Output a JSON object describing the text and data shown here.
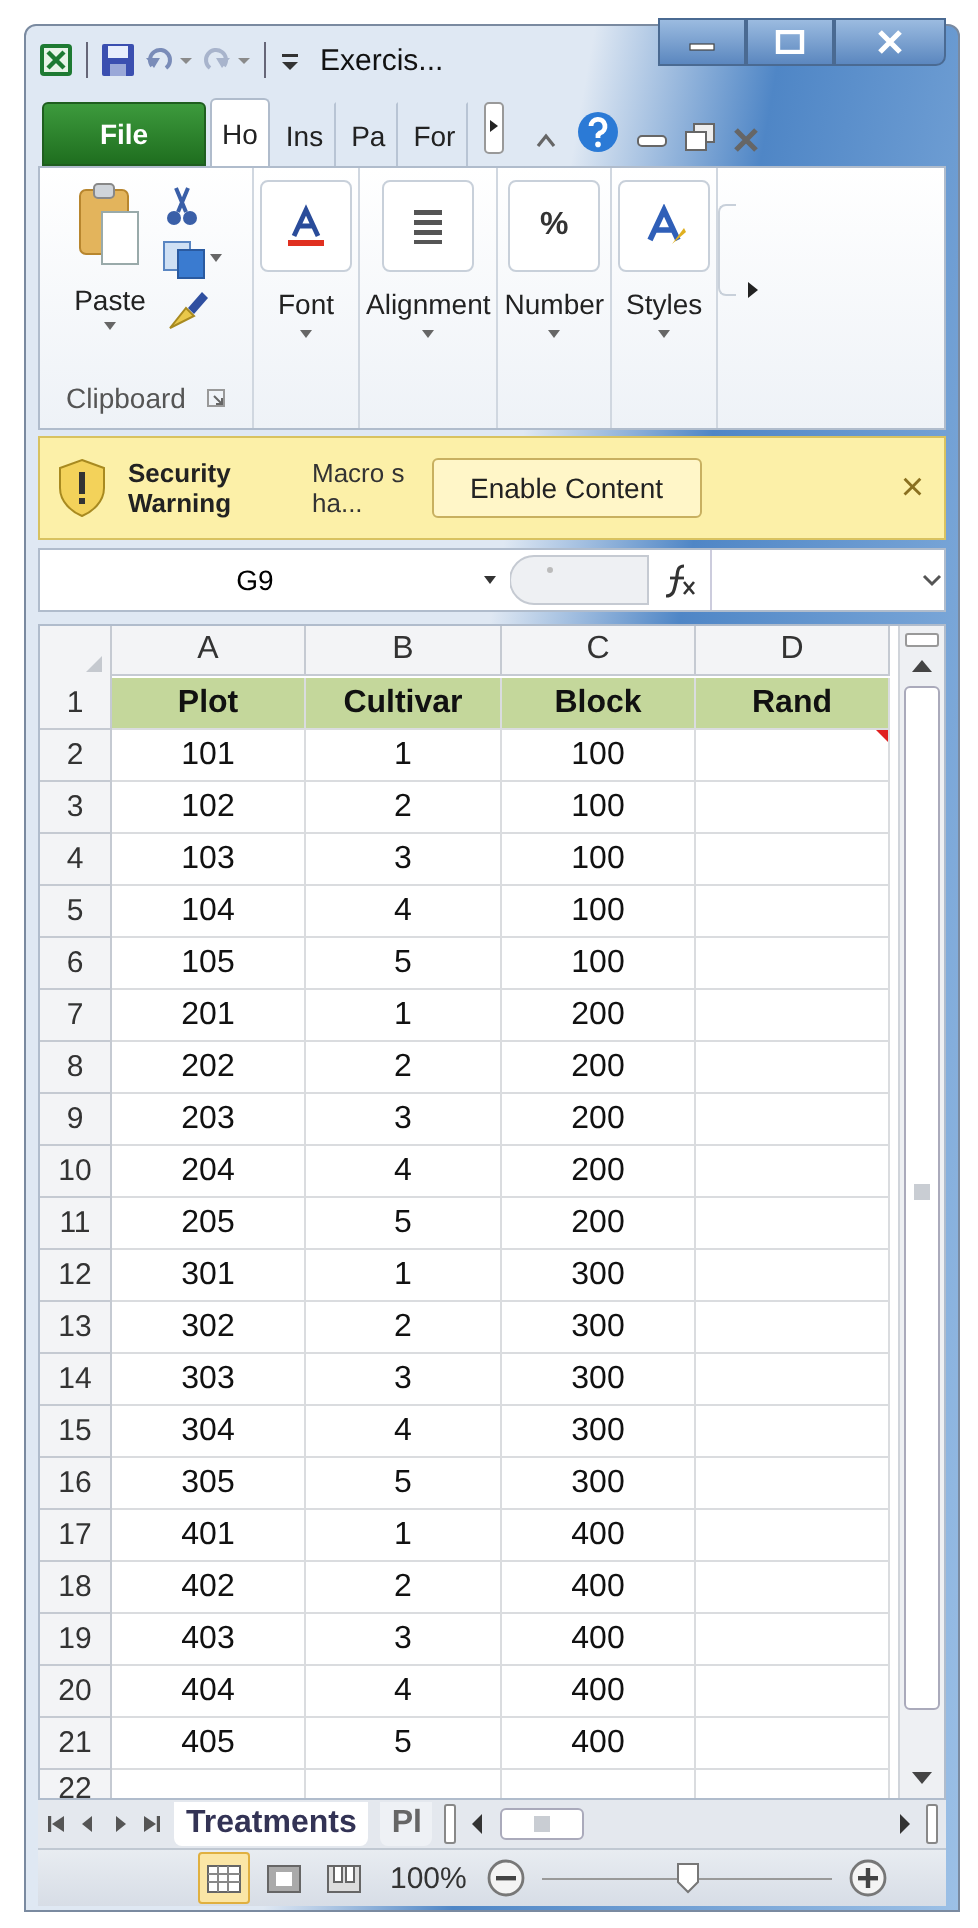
{
  "window": {
    "title": "Exercis..."
  },
  "ribbon_tabs": [
    {
      "label": "File",
      "kind": "file",
      "selected": false
    },
    {
      "label": "Ho",
      "kind": "tab",
      "selected": true
    },
    {
      "label": "Ins",
      "kind": "tab",
      "selected": false
    },
    {
      "label": "Pa",
      "kind": "tab",
      "selected": false
    },
    {
      "label": "For",
      "kind": "tab",
      "selected": false
    }
  ],
  "ribbon": {
    "clipboard": {
      "paste": "Paste",
      "group": "Clipboard"
    },
    "groups": [
      {
        "label": "Font",
        "kind": "font"
      },
      {
        "label": "Alignment",
        "kind": "alignment"
      },
      {
        "label": "Number",
        "kind": "number",
        "icon_text": "%"
      },
      {
        "label": "Styles",
        "kind": "styles"
      }
    ]
  },
  "security_bar": {
    "title": "Security Warning",
    "message": "Macro s ha...",
    "button": "Enable Content",
    "close": "×"
  },
  "formula_bar": {
    "name_box": "G9"
  },
  "columns": [
    "A",
    "B",
    "C",
    "D"
  ],
  "header_row": {
    "number": "1",
    "cells": [
      "Plot",
      "Cultivar",
      "Block",
      "Rand"
    ]
  },
  "rows": [
    {
      "number": "2",
      "plot": "101",
      "cultivar": "1",
      "block": "100",
      "comment": true
    },
    {
      "number": "3",
      "plot": "102",
      "cultivar": "2",
      "block": "100",
      "comment": false
    },
    {
      "number": "4",
      "plot": "103",
      "cultivar": "3",
      "block": "100",
      "comment": false
    },
    {
      "number": "5",
      "plot": "104",
      "cultivar": "4",
      "block": "100",
      "comment": false
    },
    {
      "number": "6",
      "plot": "105",
      "cultivar": "5",
      "block": "100",
      "comment": false
    },
    {
      "number": "7",
      "plot": "201",
      "cultivar": "1",
      "block": "200",
      "comment": false
    },
    {
      "number": "8",
      "plot": "202",
      "cultivar": "2",
      "block": "200",
      "comment": false
    },
    {
      "number": "9",
      "plot": "203",
      "cultivar": "3",
      "block": "200",
      "comment": false
    },
    {
      "number": "10",
      "plot": "204",
      "cultivar": "4",
      "block": "200",
      "comment": false
    },
    {
      "number": "11",
      "plot": "205",
      "cultivar": "5",
      "block": "200",
      "comment": false
    },
    {
      "number": "12",
      "plot": "301",
      "cultivar": "1",
      "block": "300",
      "comment": false
    },
    {
      "number": "13",
      "plot": "302",
      "cultivar": "2",
      "block": "300",
      "comment": false
    },
    {
      "number": "14",
      "plot": "303",
      "cultivar": "3",
      "block": "300",
      "comment": false
    },
    {
      "number": "15",
      "plot": "304",
      "cultivar": "4",
      "block": "300",
      "comment": false
    },
    {
      "number": "16",
      "plot": "305",
      "cultivar": "5",
      "block": "300",
      "comment": false
    },
    {
      "number": "17",
      "plot": "401",
      "cultivar": "1",
      "block": "400",
      "comment": false
    },
    {
      "number": "18",
      "plot": "402",
      "cultivar": "2",
      "block": "400",
      "comment": false
    },
    {
      "number": "19",
      "plot": "403",
      "cultivar": "3",
      "block": "400",
      "comment": false
    },
    {
      "number": "20",
      "plot": "404",
      "cultivar": "4",
      "block": "400",
      "comment": false
    },
    {
      "number": "21",
      "plot": "405",
      "cultivar": "5",
      "block": "400",
      "comment": false
    }
  ],
  "partial_row": {
    "number": "22"
  },
  "sheet_tabs": [
    {
      "label": "Treatments",
      "selected": true
    },
    {
      "label": "Pl",
      "selected": false
    }
  ],
  "status_bar": {
    "views": [
      {
        "kind": "normal",
        "selected": true
      },
      {
        "kind": "layout",
        "selected": false
      },
      {
        "kind": "break",
        "selected": false
      }
    ],
    "zoom": "100%",
    "zoom_slider": {
      "level": 0.5
    }
  }
}
